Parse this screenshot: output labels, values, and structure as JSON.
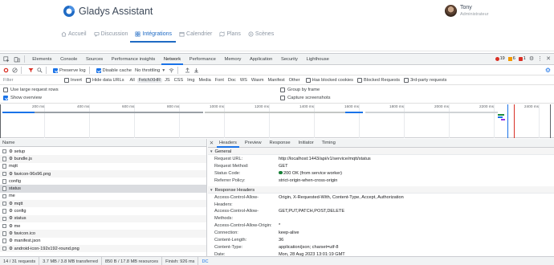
{
  "app": {
    "title": "Gladys Assistant",
    "user": {
      "name": "Tony",
      "role": "Administrateur"
    },
    "nav": [
      {
        "label": "Accueil",
        "active": false
      },
      {
        "label": "Discussion",
        "active": false
      },
      {
        "label": "Intégrations",
        "active": true
      },
      {
        "label": "Calendrier",
        "active": false
      },
      {
        "label": "Plans",
        "active": false
      },
      {
        "label": "Scènes",
        "active": false
      }
    ],
    "accent": "#206bc4"
  },
  "devtools": {
    "tabs": [
      "Elements",
      "Console",
      "Sources",
      "Performance insights",
      "Network",
      "Performance",
      "Memory",
      "Application",
      "Security",
      "Lighthouse"
    ],
    "active_tab": "Network",
    "badges": {
      "errors": "19",
      "warnings": "6",
      "issues": "1"
    },
    "toolbar": {
      "preserve_log": "Preserve log",
      "disable_cache": "Disable cache",
      "throttling": "No throttling"
    },
    "filter": {
      "placeholder": "Filter",
      "invert": "Invert",
      "hide_data_urls": "Hide data URLs",
      "types": [
        "All",
        "Fetch/XHR",
        "JS",
        "CSS",
        "Img",
        "Media",
        "Font",
        "Doc",
        "WS",
        "Wasm",
        "Manifest",
        "Other"
      ],
      "active_type": "Fetch/XHR",
      "has_blocked_cookies": "Has blocked cookies",
      "blocked_requests": "Blocked Requests",
      "third_party": "3rd-party requests"
    },
    "options": {
      "large_rows": "Use large request rows",
      "show_overview": "Show overview",
      "group_by_frame": "Group by frame",
      "capture_screenshots": "Capture screenshots"
    },
    "overview_ticks": [
      "200 ms",
      "400 ms",
      "600 ms",
      "800 ms",
      "1000 ms",
      "1200 ms",
      "1400 ms",
      "1600 ms",
      "1800 ms",
      "2000 ms",
      "2200 ms",
      "2400 ms"
    ],
    "requests": {
      "column": "Name",
      "items": [
        "setup",
        "bundle.js",
        "mqtt",
        "favicon-96x96.png",
        "config",
        "status",
        "me",
        "mqtt",
        "config",
        "status",
        "me",
        "favicon.ico",
        "manifest.json",
        "android-icon-192x192-round.png"
      ],
      "selected": "status"
    },
    "detail": {
      "tabs": [
        "Headers",
        "Preview",
        "Response",
        "Initiator",
        "Timing"
      ],
      "active": "Headers",
      "general_title": "General",
      "general": [
        {
          "k": "Request URL:",
          "v": "http://localhost:1443/api/v1/service/mqtt/status"
        },
        {
          "k": "Request Method:",
          "v": "GET"
        },
        {
          "k": "Status Code:",
          "v": "200 OK (from service worker)"
        },
        {
          "k": "Referrer Policy:",
          "v": "strict-origin-when-cross-origin"
        }
      ],
      "response_title": "Response Headers",
      "response": [
        {
          "k": "Access-Control-Allow-",
          "k2": "Headers:",
          "v": "Origin, X-Requested-With, Content-Type, Accept, Authorization"
        },
        {
          "k": "Access-Control-Allow-",
          "k2": "Methods:",
          "v": "GET,PUT,PATCH,POST,DELETE"
        },
        {
          "k": "Access-Control-Allow-Origin:",
          "v": "*"
        },
        {
          "k": "Connection:",
          "v": "keep-alive"
        },
        {
          "k": "Content-Length:",
          "v": "36"
        },
        {
          "k": "Content-Type:",
          "v": "application/json; charset=utf-8"
        },
        {
          "k": "Date:",
          "v": "Mon, 28 Aug 2023 13:01:19 GMT"
        }
      ]
    },
    "statusbar": [
      "14 / 31 requests",
      "3.7 MB / 3.8 MB transferred",
      "850 B / 17.8 MB resources",
      "Finish: 926 ms",
      "DC"
    ]
  }
}
